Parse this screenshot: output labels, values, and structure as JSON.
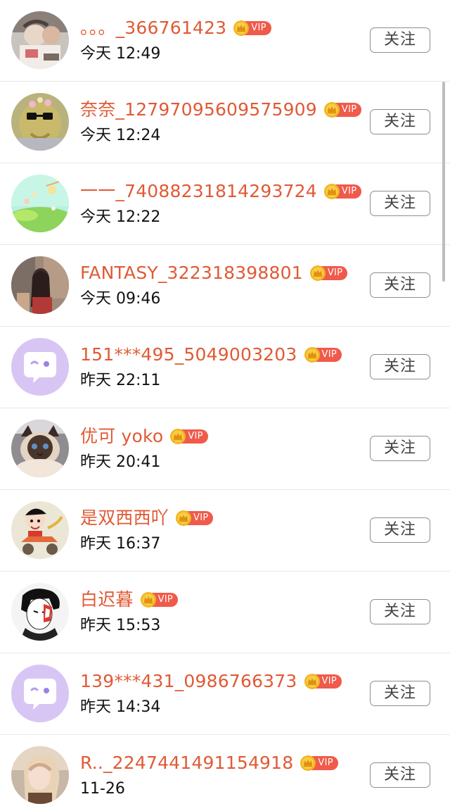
{
  "follow_label": "关注",
  "vip_label": "VIP",
  "colors": {
    "username": "#e05a35",
    "vip_pill": "#f05a4a",
    "crown": "#f2b51c",
    "divider": "#e8e8e8",
    "button_border": "#8d8d8d"
  },
  "users": [
    {
      "username": "。。。_366761423",
      "time": "今天 12:49",
      "avatar": "photo-avatar"
    },
    {
      "username": "奈奈_12797095609575909",
      "time": "今天 12:24",
      "avatar": "photo-avatar"
    },
    {
      "username": "一一_74088231814293724",
      "time": "今天 12:22",
      "avatar": "illustration-avatar"
    },
    {
      "username": "FANTASY_322318398801",
      "time": "今天 09:46",
      "avatar": "photo-avatar"
    },
    {
      "username": "151***495_5049003203",
      "time": "昨天 22:11",
      "avatar": "default-chat-avatar"
    },
    {
      "username": "优可 yoko",
      "time": "昨天 20:41",
      "avatar": "cat-photo-avatar"
    },
    {
      "username": "是双西西吖",
      "time": "昨天 16:37",
      "avatar": "cartoon-avatar"
    },
    {
      "username": "白迟暮",
      "time": "昨天 15:53",
      "avatar": "anime-avatar"
    },
    {
      "username": "139***431_0986766373",
      "time": "昨天 14:34",
      "avatar": "default-chat-avatar"
    },
    {
      "username": "R.._2247441491154918",
      "time": "11-26",
      "avatar": "photo-avatar"
    }
  ]
}
